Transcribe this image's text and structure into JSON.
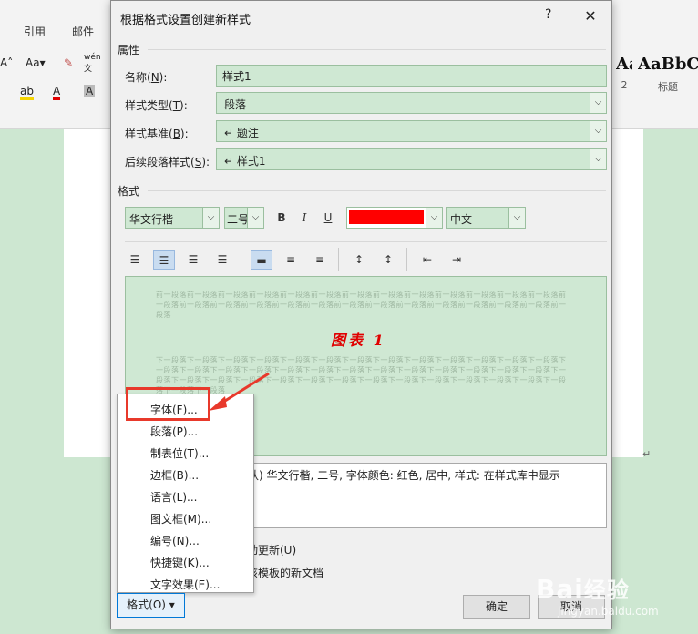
{
  "background": {
    "ribbon_tabs": [
      "引用",
      "邮件"
    ],
    "style_gallery": [
      {
        "sample": "AaBbC",
        "label": "2"
      },
      {
        "sample": "AaBbC",
        "label": "标题"
      }
    ],
    "paragraph_mark": "↵"
  },
  "dialog": {
    "title": "根据格式设置创建新样式",
    "help": "?",
    "close": "✕",
    "properties_section": "属性",
    "name_label": "名称(",
    "name_key": "N",
    "name_label_tail": "):",
    "name_value": "样式1",
    "style_type_label": "样式类型(",
    "style_type_key": "T",
    "style_type_label_tail": "):",
    "style_type_value": "段落",
    "based_on_label": "样式基准(",
    "based_on_key": "B",
    "based_on_label_tail": "):",
    "based_on_value": "↵ 题注",
    "following_label": "后续段落样式(",
    "following_key": "S",
    "following_label_tail": "):",
    "following_value": "↵ 样式1",
    "format_section": "格式",
    "font_name": "华文行楷",
    "font_size": "二号",
    "bold": "B",
    "italic": "I",
    "underline": "U",
    "font_color": "#ff0000",
    "language": "中文",
    "preview_prev_text": "前一段落前一段落前一段落前一段落前一段落前一段落前一段落前一段落前一段落前一段落前一段落前一段落前一段落前一段落前一段落前一段落前一段落前一段落前一段落前一段落前一段落前一段落前一段落前一段落前一段落前一段落前一段落",
    "preview_main_text": "图表 1",
    "preview_next_text": "下一段落下一段落下一段落下一段落下一段落下一段落下一段落下一段落下一段落下一段落下一段落下一段落下一段落下一段落下一段落下一段落下一段落下一段落下一段落下一段落下一段落下一段落下一段落下一段落下一段落下一段落下一段落下一段落下一段落下一段落下一段落下一段落下一段落下一段落下一段落下一段落下一段落下一段落下一段落下一段落下一段落下一段落",
    "description_text": "认) 华文行楷, 二号, 字体颜色: 红色, 居中, 样式: 在样式库中显示",
    "auto_update_label": "动更新(U)",
    "new_docs_label": "该模板的新文档",
    "ok": "确定",
    "cancel": "取消",
    "format_button": "格式(O) ▾"
  },
  "format_menu": [
    "字体(F)...",
    "段落(P)...",
    "制表位(T)...",
    "边框(B)...",
    "语言(L)...",
    "图文框(M)...",
    "编号(N)...",
    "快捷键(K)...",
    "文字效果(E)..."
  ],
  "watermark": {
    "logo": "Bai",
    "cn": "经验",
    "url": "jingyan.baidu.com"
  },
  "colors": {
    "highlight": "#e8392b",
    "field_bg": "#cfe8d3",
    "accent": "#0078d7"
  }
}
